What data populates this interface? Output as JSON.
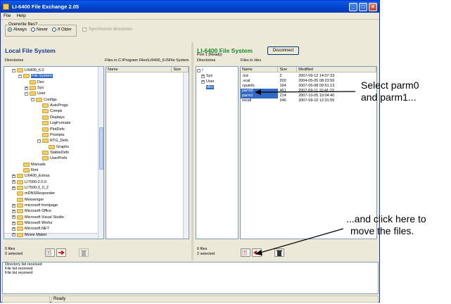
{
  "window": {
    "title": "LI-6400 File Exchange 2.05"
  },
  "menu": [
    "File",
    "Help"
  ],
  "overwrite": {
    "legend": "Overwrite files?",
    "options": [
      "Always",
      "Never",
      "If Older"
    ],
    "selected": "Always",
    "synchronize_label": "Synchronize directories"
  },
  "local": {
    "title": "Local File System",
    "dirs_label": "Directories",
    "files_label": "Files in C:\\Program Files\\LI6400_6.0\\File System",
    "col_name": "Name",
    "col_size": "Size",
    "tree": [
      {
        "label": "LI6400_6.0",
        "level": 1,
        "plus": "-"
      },
      {
        "label": "File System",
        "level": 2,
        "plus": "-",
        "selected": true
      },
      {
        "label": "Dev",
        "level": 3,
        "plus": ""
      },
      {
        "label": "Sys",
        "level": 3,
        "plus": "+"
      },
      {
        "label": "User",
        "level": 3,
        "plus": "-"
      },
      {
        "label": "Configs",
        "level": 4,
        "plus": "-"
      },
      {
        "label": "AutoProgs",
        "level": 5,
        "plus": ""
      },
      {
        "label": "Comps",
        "level": 5,
        "plus": ""
      },
      {
        "label": "Displays",
        "level": 5,
        "plus": ""
      },
      {
        "label": "LogFormats",
        "level": 5,
        "plus": ""
      },
      {
        "label": "PlotDefs",
        "level": 5,
        "plus": ""
      },
      {
        "label": "Prompts",
        "level": 5,
        "plus": ""
      },
      {
        "label": "RTG_Defs",
        "level": 5,
        "plus": "-"
      },
      {
        "label": "Graphs",
        "level": 6,
        "plus": ""
      },
      {
        "label": "StableDefs",
        "level": 5,
        "plus": ""
      },
      {
        "label": "UserPrefs",
        "level": 5,
        "plus": ""
      },
      {
        "label": "Manuals",
        "level": 2,
        "plus": ""
      },
      {
        "label": "Rmt",
        "level": 2,
        "plus": ""
      },
      {
        "label": "LI6400_Extras",
        "level": 1,
        "plus": "+"
      },
      {
        "label": "LI7000-2.0.0",
        "level": 1,
        "plus": "+"
      },
      {
        "label": "LI7500-3_0_2",
        "level": 1,
        "plus": "+"
      },
      {
        "label": "mDNSResponder",
        "level": 1,
        "plus": ""
      },
      {
        "label": "Messenger",
        "level": 1,
        "plus": ""
      },
      {
        "label": "microsoft frontpage",
        "level": 1,
        "plus": "+"
      },
      {
        "label": "Microsoft Office",
        "level": 1,
        "plus": "+"
      },
      {
        "label": "Microsoft Visual Studio",
        "level": 1,
        "plus": "+"
      },
      {
        "label": "Microsoft Works",
        "level": 1,
        "plus": "+"
      },
      {
        "label": "Microsoft.NET",
        "level": 1,
        "plus": "+"
      },
      {
        "label": "Movie Maker",
        "level": 1,
        "plus": "+"
      }
    ],
    "footer_files": "0 files",
    "footer_selected": "0 selected"
  },
  "remote": {
    "title": "LI-6400 File System",
    "disconnect_label": "Disconnect",
    "port": "Port 1 (Ready)",
    "dirs_label": "Directories",
    "files_label": "Files in /dev",
    "col_name": "Name",
    "col_size": "Size",
    "col_modified": "Modified",
    "tree": [
      {
        "label": "/",
        "level": 0,
        "plus": "-"
      },
      {
        "label": "Sys",
        "level": 1,
        "plus": "+"
      },
      {
        "label": "User",
        "level": 1,
        "plus": "+"
      },
      {
        "label": "dev",
        "level": 1,
        "plus": "",
        "selected": true
      }
    ],
    "files": [
      {
        "name": ".lcd",
        "size": "2",
        "modified": "2007-09-12 14:07:33",
        "selected": false
      },
      {
        "name": ".vcal",
        "size": "200",
        "modified": "2004-05-05 08:23:56",
        "selected": false
      },
      {
        "name": "cpuinfo",
        "size": "164",
        "modified": "2007-05-08 09:51:13",
        "selected": false
      },
      {
        "name": "parm0",
        "size": "461",
        "modified": "2007-09-11 10:41:23",
        "selected": true
      },
      {
        "name": "parm1",
        "size": "214",
        "modified": "2007-10-05 10:04:40",
        "selected": true
      },
      {
        "name": "recall",
        "size": "246",
        "modified": "2007-09-10 12:31:55",
        "selected": false
      }
    ],
    "footer_files": "6 files",
    "footer_selected": "2 selected"
  },
  "log": [
    "Directory list received",
    "File list received",
    "File list received"
  ],
  "status": {
    "ready": "Ready"
  },
  "callouts": {
    "select_line1": "Select parm0",
    "select_line2": "and parm1...",
    "click_line1": "...and click here to",
    "click_line2": "move the files."
  },
  "colors": {
    "selection": "#316ac5",
    "local_title": "#1a3a8a",
    "remote_title": "#1a8a2a",
    "titlebar": "#0a5ce6"
  }
}
